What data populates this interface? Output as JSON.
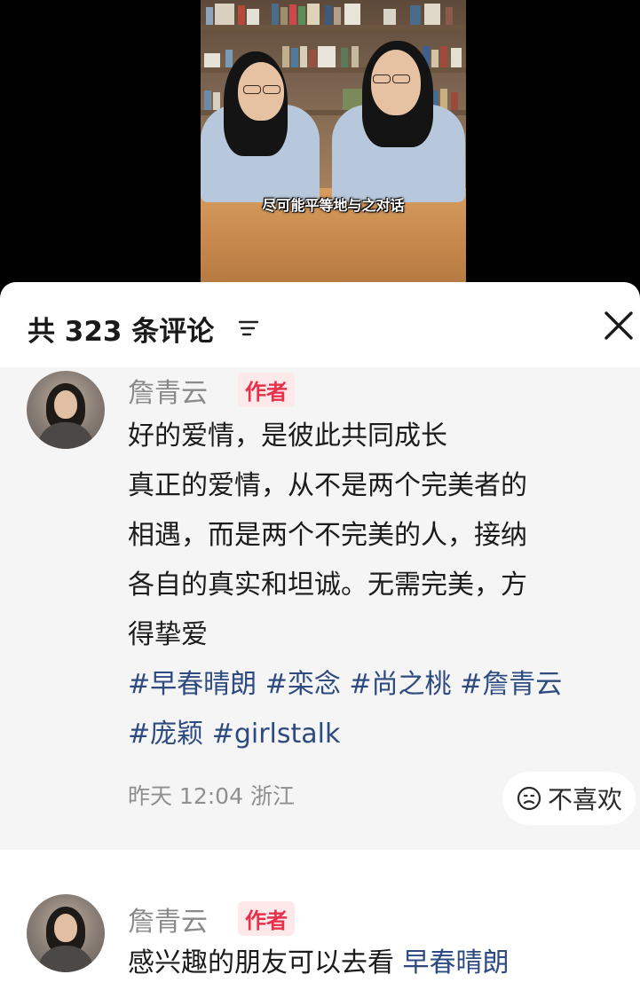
{
  "video": {
    "subtitle": "尽可能平等地与之对话"
  },
  "comments_panel": {
    "title": "共 323 条评论",
    "sort_icon": "sort-lines-icon",
    "close_icon": "close-x-icon"
  },
  "comments": [
    {
      "username": "詹青云",
      "badge": "作者",
      "lines": [
        "好的爱情，是彼此共同成长",
        "真正的爱情，从不是两个完美者的",
        "相遇，而是两个不完美的人，接纳",
        "各自的真实和坦诚。无需完美，方",
        "得挚爱"
      ],
      "hashtags_line1": [
        "#早春晴朗",
        "#栾念",
        "#尚之桃",
        "#詹青云"
      ],
      "hashtags_line2": [
        "#庞颖",
        "#girlstalk"
      ],
      "time_location": "昨天 12:04 浙江",
      "dislike_label": "不喜欢",
      "dislike_icon": "frown-face-icon"
    },
    {
      "username": "詹青云",
      "badge": "作者",
      "text_prefix": "感兴趣的朋友可以去看",
      "text_link": "早春晴朗"
    }
  ]
}
